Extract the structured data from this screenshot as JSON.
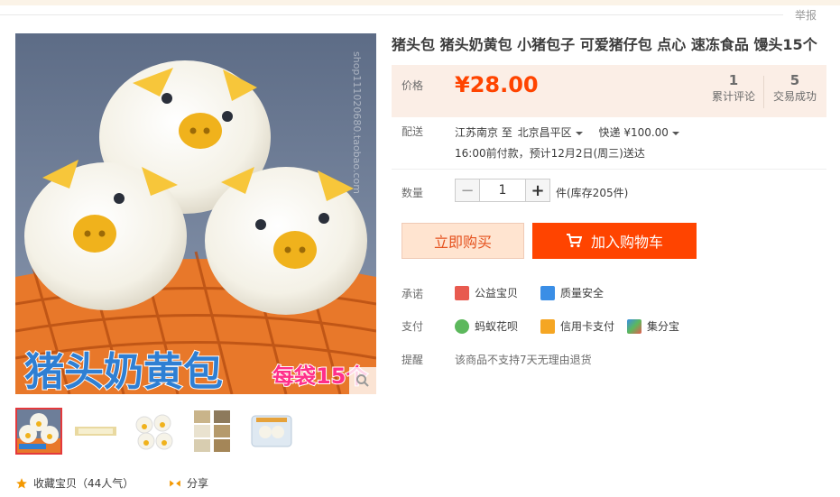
{
  "header": {
    "report_label": "举报"
  },
  "product": {
    "title": "猪头包 猪头奶黄包 小猪包子 可爱猪仔包 点心 速冻食品 馒头15个",
    "image_overlay_text": "猪头奶黄包",
    "image_badge_text": "每袋15个",
    "watermark": "shop111020680.taobao.com"
  },
  "price": {
    "label": "价格",
    "value": "¥28.00"
  },
  "stats": [
    {
      "count": "1",
      "label": "累计评论"
    },
    {
      "count": "5",
      "label": "交易成功"
    }
  ],
  "delivery": {
    "label": "配送",
    "from": "江苏南京 至",
    "to": "北京昌平区",
    "method": "快递 ¥100.00",
    "note": "16:00前付款，预计12月2日(周三)送达"
  },
  "quantity": {
    "label": "数量",
    "minus": "−",
    "value": "1",
    "plus": "+",
    "stock": "件(库存205件)"
  },
  "actions": {
    "buy_now": "立即购买",
    "add_to_cart": "加入购物车"
  },
  "promise": {
    "label": "承诺",
    "items": [
      "公益宝贝",
      "质量安全"
    ]
  },
  "payment": {
    "label": "支付",
    "items": [
      "蚂蚁花呗",
      "信用卡支付",
      "集分宝"
    ]
  },
  "reminder": {
    "label": "提醒",
    "text": "该商品不支持7天无理由退货"
  },
  "footer": {
    "favorite": "收藏宝贝（44人气）",
    "share": "分享"
  },
  "colors": {
    "accent": "#ff4400",
    "price": "#ff4400",
    "price_bg": "#fbeee6"
  }
}
